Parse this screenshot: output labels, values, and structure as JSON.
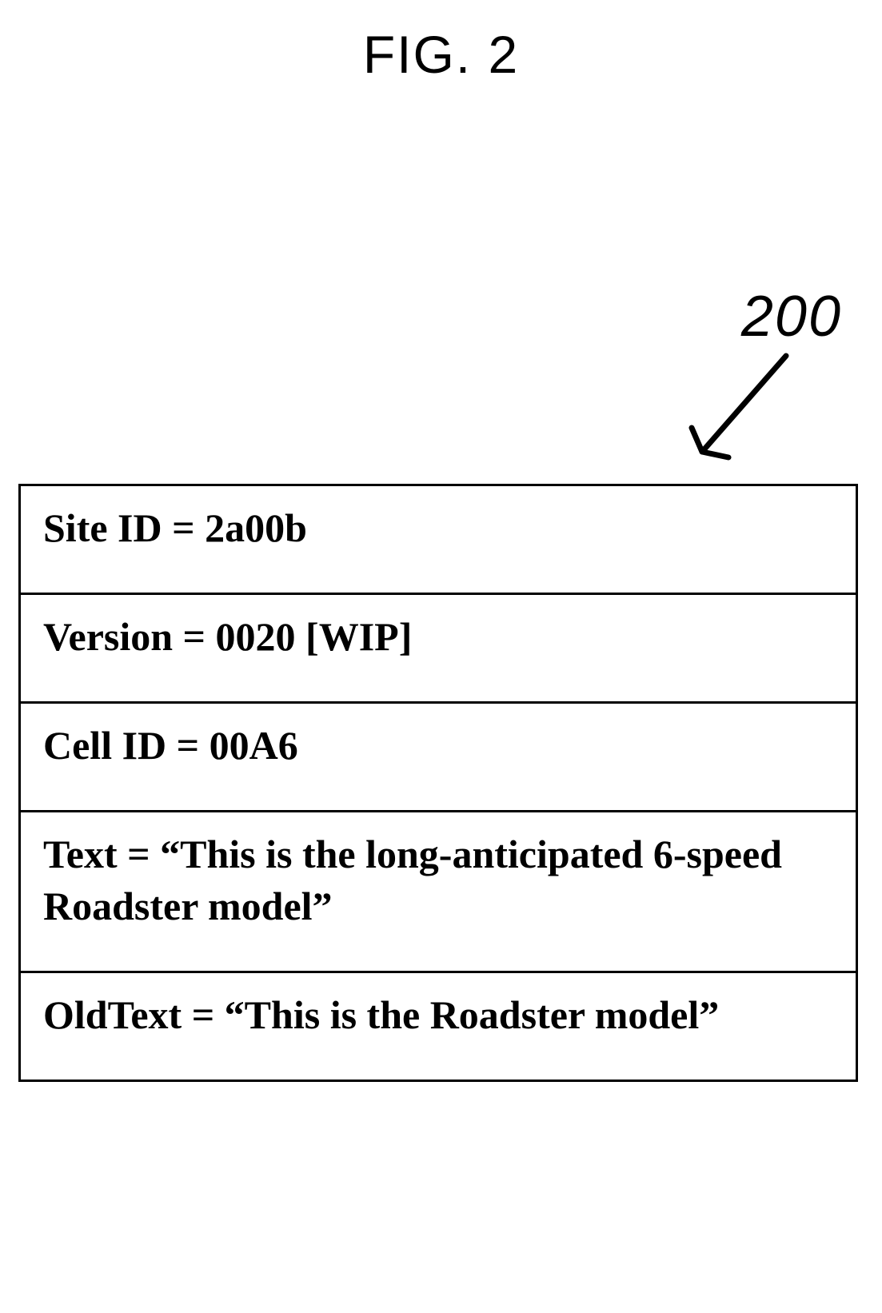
{
  "figure": {
    "title": "FIG. 2",
    "annotation_label": "200"
  },
  "rows": [
    {
      "text": "Site ID = 2a00b"
    },
    {
      "text": "Version = 0020 [WIP]"
    },
    {
      "text": "Cell ID = 00A6"
    },
    {
      "text": "Text = “This is the long-anticipated 6-speed Roadster model”"
    },
    {
      "text": "OldText = “This is the Roadster model”"
    }
  ]
}
